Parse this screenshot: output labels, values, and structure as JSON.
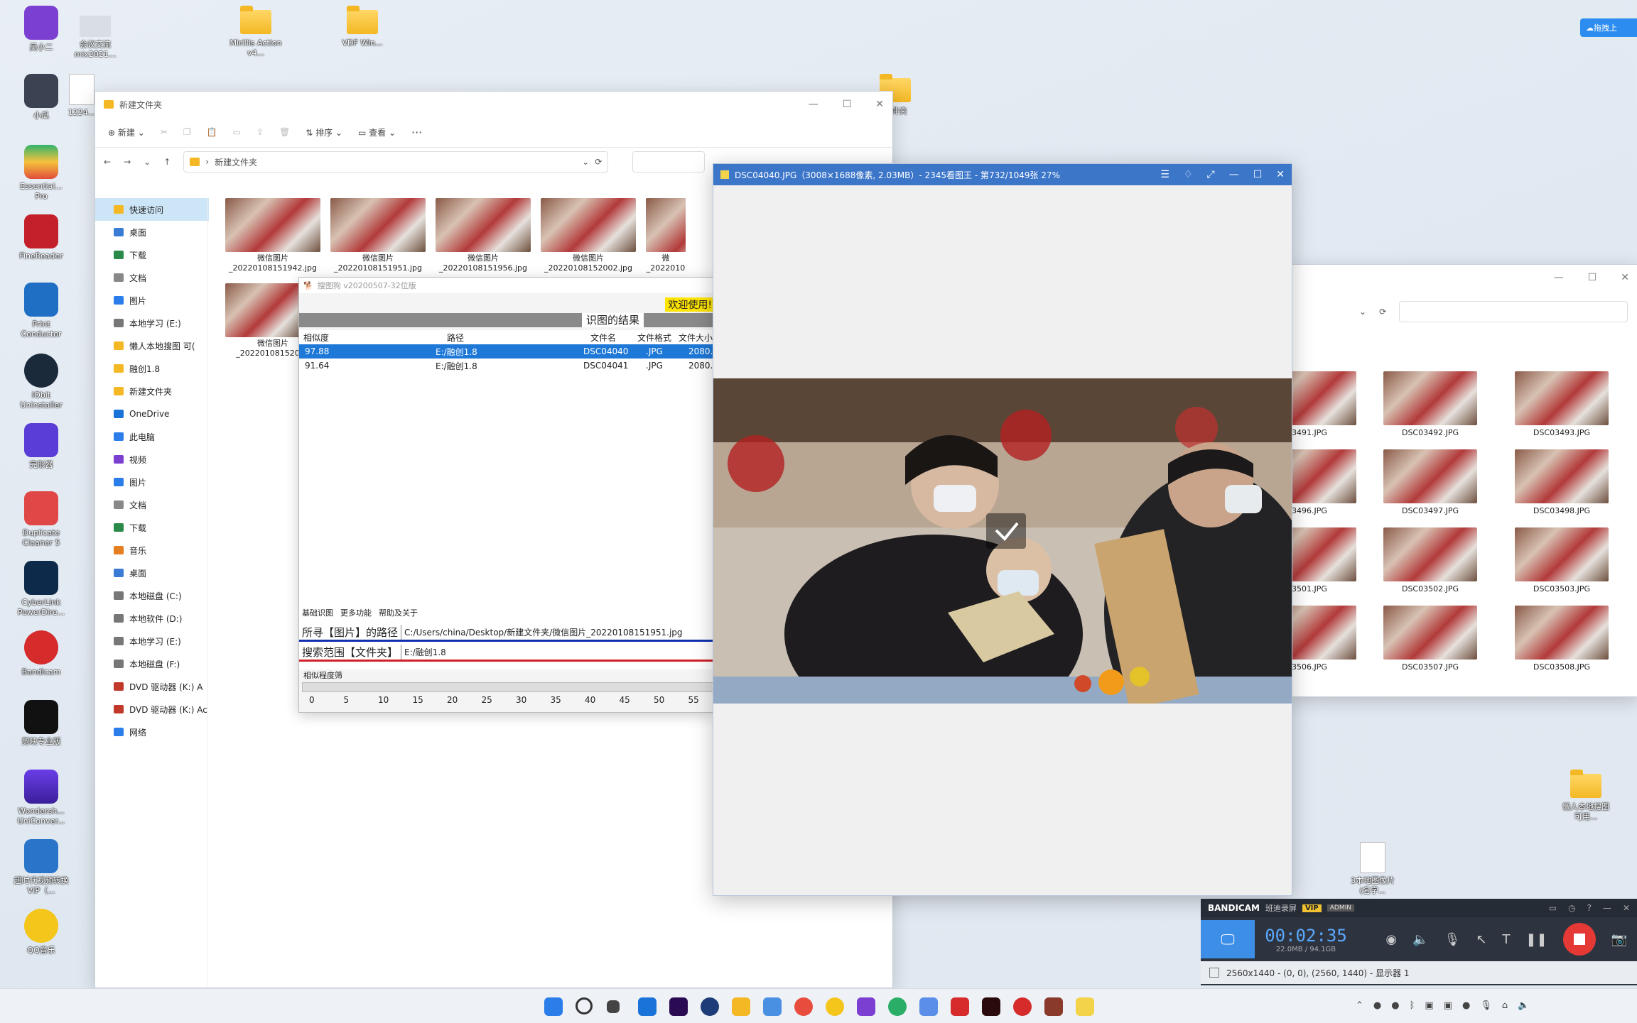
{
  "desktop": {
    "icons": [
      {
        "label": "吴小二"
      },
      {
        "label": "会议交流mix2021..."
      },
      {
        "label": "Mirillis Action v4..."
      },
      {
        "label": "VDF Win..."
      },
      {
        "label": "小瓜"
      },
      {
        "label": "1224..."
      },
      {
        "label": "Essential... Pro"
      },
      {
        "label": "FineReader"
      },
      {
        "label": "Print Conductor"
      },
      {
        "label": "IObit Uninstaller"
      },
      {
        "label": "完形器"
      },
      {
        "label": "Duplicate Cleaner 5"
      },
      {
        "label": "CyberLink PowerDire..."
      },
      {
        "label": "Bandicam"
      },
      {
        "label": "剪映专业版"
      },
      {
        "label": "Wondersh... UniConver..."
      },
      {
        "label": "超时代视频转换VIP（..."
      },
      {
        "label": "QQ音乐"
      },
      {
        "label": "文件夹"
      },
      {
        "label": "懒人本地搜图 可用..."
      },
      {
        "label": "3本地图像片 (名字..."
      },
      {
        "label": "拖拽上"
      }
    ]
  },
  "explorer": {
    "title": "新建文件夹",
    "toolbar": {
      "new": "新建",
      "sort": "排序",
      "view": "查看",
      "more": "···"
    },
    "breadcrumb": "新建文件夹",
    "nav": [
      {
        "label": "快速访问",
        "type": "quick"
      },
      {
        "label": "桌面",
        "type": "desktop"
      },
      {
        "label": "下载",
        "type": "download"
      },
      {
        "label": "文档",
        "type": "doc"
      },
      {
        "label": "图片",
        "type": "pic"
      },
      {
        "label": "本地学习 (E:)",
        "type": "drive"
      },
      {
        "label": "懒人本地搜图 可(",
        "type": "folder"
      },
      {
        "label": "融创1.8",
        "type": "folder"
      },
      {
        "label": "新建文件夹",
        "type": "folder"
      },
      {
        "label": "OneDrive",
        "type": "cloud"
      },
      {
        "label": "此电脑",
        "type": "pc"
      },
      {
        "label": "视频",
        "type": "video"
      },
      {
        "label": "图片",
        "type": "pic"
      },
      {
        "label": "文档",
        "type": "doc"
      },
      {
        "label": "下载",
        "type": "download"
      },
      {
        "label": "音乐",
        "type": "music"
      },
      {
        "label": "桌面",
        "type": "desktop"
      },
      {
        "label": "本地磁盘 (C:)",
        "type": "drive"
      },
      {
        "label": "本地软件 (D:)",
        "type": "drive"
      },
      {
        "label": "本地学习 (E:)",
        "type": "drive"
      },
      {
        "label": "本地磁盘 (F:)",
        "type": "drive"
      },
      {
        "label": "DVD 驱动器 (K:) A",
        "type": "dvd"
      },
      {
        "label": "DVD 驱动器 (K:) Ac",
        "type": "dvd"
      },
      {
        "label": "网络",
        "type": "net"
      }
    ],
    "files": [
      {
        "line1": "微信图片",
        "line2": "_20220108151942.jpg"
      },
      {
        "line1": "微信图片",
        "line2": "_20220108151951.jpg"
      },
      {
        "line1": "微信图片",
        "line2": "_20220108151956.jpg"
      },
      {
        "line1": "微信图片",
        "line2": "_20220108152002.jpg"
      },
      {
        "line1": "微",
        "line2": "_2022010"
      }
    ],
    "files_row2": [
      {
        "line1": "微信图片",
        "line2": "_20220108152012"
      }
    ]
  },
  "search_app": {
    "title": "搜图狗 v20200507-32位版",
    "welcome": "欢迎使用!",
    "result_title": "识图的结果",
    "columns": [
      "相似度",
      "路径",
      "文件名",
      "文件格式",
      "文件大小"
    ],
    "rows": [
      {
        "score": "97.88",
        "path": "E:/融创1.8",
        "name": "DSC04040",
        "fmt": ".JPG",
        "size": "2080.0"
      },
      {
        "score": "91.64",
        "path": "E:/融创1.8",
        "name": "DSC04041",
        "fmt": ".JPG",
        "size": "2080.0"
      }
    ],
    "menu": [
      "基础识图",
      "更多功能",
      "帮助及关于"
    ],
    "path_label": "所寻【图片】的路径",
    "path_value": "C:/Users/china/Desktop/新建文件夹/微信图片_20220108151951.jpg",
    "range_label": "搜索范围【文件夹】",
    "range_value": "E:/融创1.8",
    "similarity_label": "相似程度筛",
    "ticks": [
      "0",
      "5",
      "10",
      "15",
      "20",
      "25",
      "30",
      "35",
      "40",
      "45",
      "50",
      "55"
    ]
  },
  "viewer": {
    "title": "DSC04040.JPG（3008×1688像素, 2.03MB）- 2345看图王 - 第732/1049张 27%"
  },
  "explorer2": {
    "files": [
      {
        "name": "3491.JPG"
      },
      {
        "name": "DSC03492.JPG"
      },
      {
        "name": "DSC03493.JPG"
      },
      {
        "name": "3496.JPG"
      },
      {
        "name": "DSC03497.JPG"
      },
      {
        "name": "DSC03498.JPG"
      },
      {
        "name": "3501.JPG"
      },
      {
        "name": "DSC03502.JPG"
      },
      {
        "name": "DSC03503.JPG"
      },
      {
        "name": "3506.JPG"
      },
      {
        "name": "DSC03507.JPG"
      },
      {
        "name": "DSC03508.JPG"
      }
    ]
  },
  "bandicam": {
    "brand": "BANDICAM",
    "mode": "班迪录屏",
    "vip": "VIP",
    "admin": "ADMIN",
    "timer": "00:02:35",
    "size": "22.0MB / 94.1GB",
    "status": "2560x1440 - (0, 0), (2560, 1440) - 显示器 1"
  },
  "colors": {
    "accent": "#3c76c9",
    "select": "#1e78d7",
    "record": "#e53935"
  }
}
